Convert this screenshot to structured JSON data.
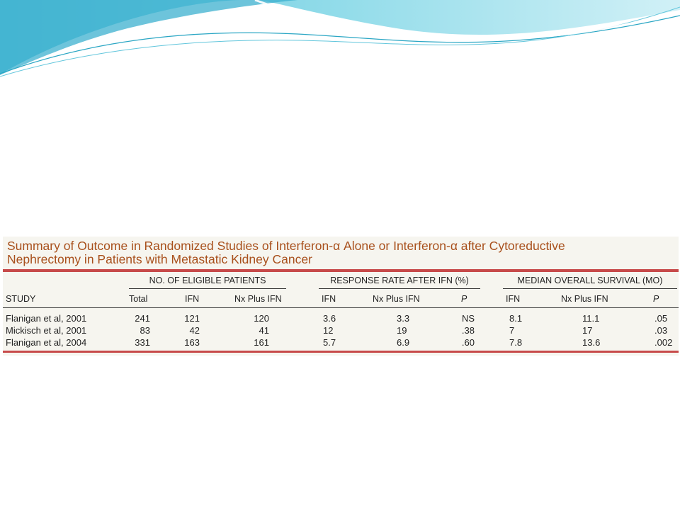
{
  "caption": {
    "line1": "Summary of Outcome in Randomized Studies of Interferon-α Alone or Interferon-α after Cytoreductive",
    "line2": "Nephrectomy in Patients with Metastatic Kidney Cancer"
  },
  "groups": {
    "eligible": "NO. OF ELIGIBLE PATIENTS",
    "response": "RESPONSE RATE AFTER IFN (%)",
    "survival": "MEDIAN OVERALL SURVIVAL (MO)"
  },
  "columns": {
    "study": "STUDY",
    "total": "Total",
    "ifn1": "IFN",
    "nx1": "Nx Plus IFN",
    "ifn2": "IFN",
    "nx2": "Nx Plus IFN",
    "p2": "P",
    "ifn3": "IFN",
    "nx3": "Nx Plus IFN",
    "p3": "P"
  },
  "rows": [
    {
      "study": "Flanigan et al, 2001",
      "total": "241",
      "ifn1": "121",
      "nx1": "120",
      "ifn2": "3.6",
      "nx2": "3.3",
      "p2": "NS",
      "ifn3": "8.1",
      "nx3": "11.1",
      "p3": ".05"
    },
    {
      "study": "Mickisch et al, 2001",
      "total": "83",
      "ifn1": "42",
      "nx1": "41",
      "ifn2": "12",
      "nx2": "19",
      "p2": ".38",
      "ifn3": "7",
      "nx3": "17",
      "p3": ".03"
    },
    {
      "study": "Flanigan et al, 2004",
      "total": "331",
      "ifn1": "163",
      "nx1": "161",
      "ifn2": "5.7",
      "nx2": "6.9",
      "p2": ".60",
      "ifn3": "7.8",
      "nx3": "13.6",
      "p3": ".002"
    }
  ],
  "colors": {
    "caption": "#a8501c",
    "rule": "#c74a4a",
    "wave_light": "#bfeaf2",
    "wave_mid": "#6fcfe2",
    "wave_dark": "#2aa6c4"
  }
}
